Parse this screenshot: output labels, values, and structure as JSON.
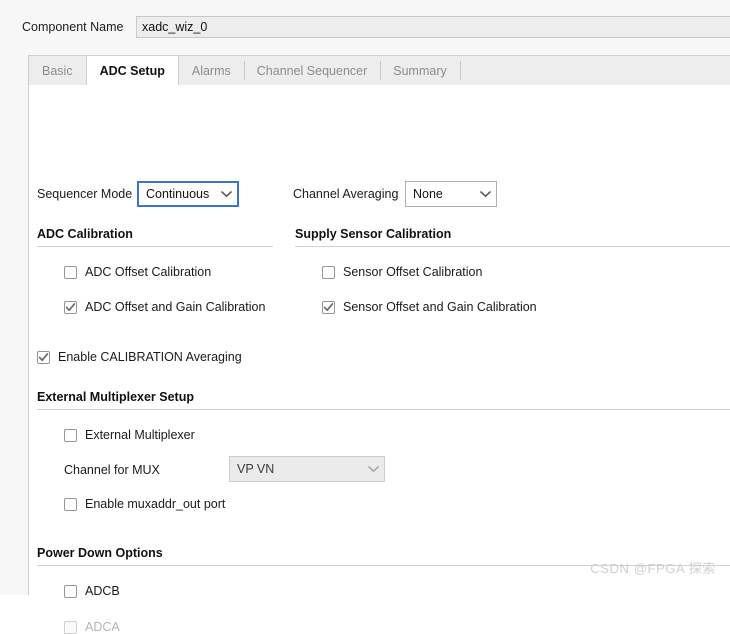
{
  "component": {
    "label": "Component Name",
    "value": "xadc_wiz_0"
  },
  "tabs": [
    {
      "label": "Basic",
      "active": false
    },
    {
      "label": "ADC Setup",
      "active": true
    },
    {
      "label": "Alarms",
      "active": false
    },
    {
      "label": "Channel Sequencer",
      "active": false
    },
    {
      "label": "Summary",
      "active": false
    }
  ],
  "controls": {
    "sequencer_mode": {
      "label": "Sequencer Mode",
      "value": "Continuous",
      "arrow": "chevron-down-icon",
      "focused": true,
      "disabled": false
    },
    "channel_averaging": {
      "label": "Channel Averaging",
      "value": "None",
      "arrow": "chevron-down-icon",
      "focused": false,
      "disabled": false
    },
    "channel_for_mux": {
      "label": "Channel for MUX",
      "value": "VP VN",
      "arrow": "chevron-down-icon",
      "focused": false,
      "disabled": true
    }
  },
  "sections": {
    "adc_calibration": {
      "title": "ADC Calibration",
      "items": [
        {
          "label": "ADC Offset Calibration",
          "checked": false,
          "disabled": false
        },
        {
          "label": "ADC Offset and Gain Calibration",
          "checked": true,
          "disabled": false
        }
      ]
    },
    "supply_sensor_calibration": {
      "title": "Supply Sensor Calibration",
      "items": [
        {
          "label": "Sensor Offset Calibration",
          "checked": false,
          "disabled": false
        },
        {
          "label": "Sensor Offset and Gain Calibration",
          "checked": true,
          "disabled": false
        }
      ]
    },
    "calibration_averaging": {
      "label": "Enable CALIBRATION Averaging",
      "checked": true,
      "disabled": false
    },
    "external_multiplexer": {
      "title": "External Multiplexer Setup",
      "items": [
        {
          "label": "External Multiplexer",
          "checked": false,
          "disabled": false
        },
        {
          "label": "Enable muxaddr_out port",
          "checked": false,
          "disabled": false
        }
      ]
    },
    "power_down": {
      "title": "Power Down Options",
      "items": [
        {
          "label": "ADCB",
          "checked": false,
          "disabled": false
        },
        {
          "label": "ADCA",
          "checked": false,
          "disabled": true
        }
      ]
    }
  },
  "watermark": "CSDN @FPGA 探索",
  "colors": {
    "focus_blue": "#3a76c8",
    "pane_bg": "#ffffff",
    "chrome_bg": "#f7f7f7",
    "tab_bg": "#ededed"
  }
}
